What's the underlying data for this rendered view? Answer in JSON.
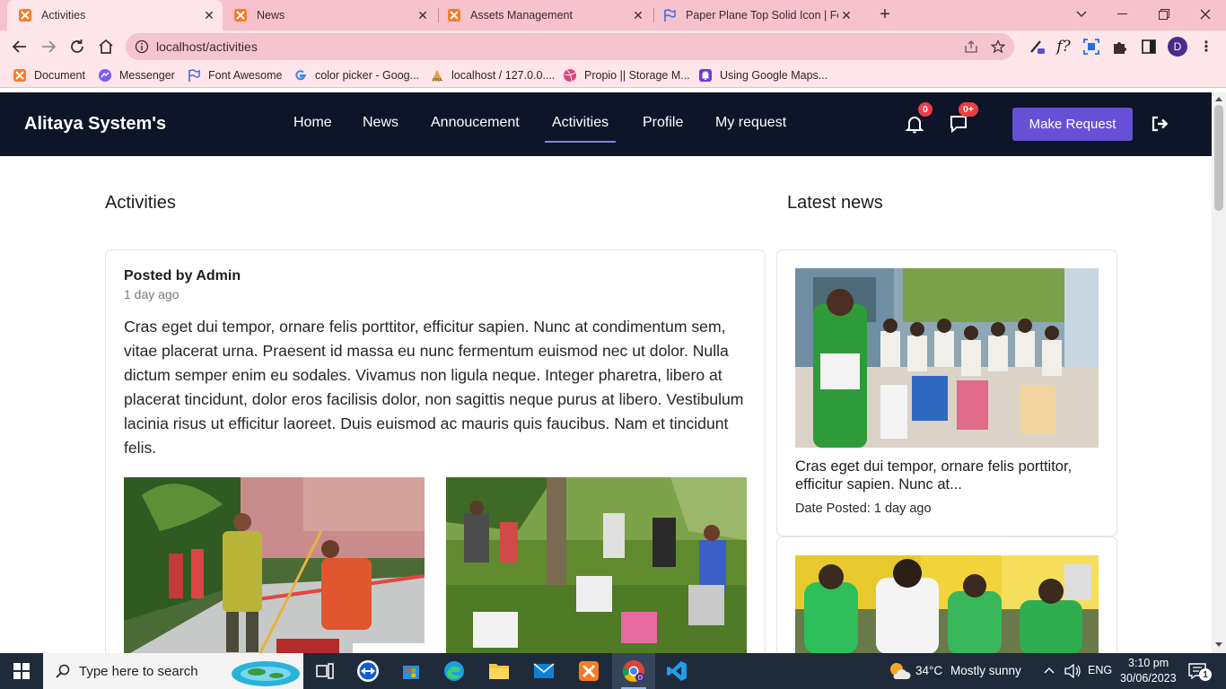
{
  "browser": {
    "tabs": [
      {
        "title": "Activities",
        "active": true
      },
      {
        "title": "News",
        "active": false
      },
      {
        "title": "Assets Management",
        "active": false
      },
      {
        "title": "Paper Plane Top Solid Icon | Font",
        "active": false
      }
    ],
    "address": "localhost/activities",
    "bookmarks": [
      "Document",
      "Messenger",
      "Font Awesome",
      "color picker - Goog...",
      "localhost / 127.0.0....",
      "Propio || Storage M...",
      "Using Google Maps..."
    ],
    "profile_initial": "D",
    "colors": {
      "tab_strip": "#f7c1cd",
      "toolbar": "#fde5ea"
    }
  },
  "app": {
    "brand": "Alitaya System's",
    "nav": {
      "home": "Home",
      "news": "News",
      "announcement": "Annoucement",
      "activities": "Activities",
      "profile": "Profile",
      "my_request": "My request"
    },
    "active_nav": "Activities",
    "notifications_badge": "0",
    "messages_badge": "0+",
    "make_request": "Make Request",
    "colors": {
      "navbar": "#0e1528",
      "accent": "#6651d6",
      "badge": "#ee3e45"
    }
  },
  "activities": {
    "heading": "Activities",
    "post": {
      "author": "Posted by Admin",
      "time": "1 day ago",
      "body": "Cras eget dui tempor, ornare felis porttitor, efficitur sapien. Nunc at condimentum sem, vitae placerat urna. Praesent id massa eu nunc fermentum euismod nec ut dolor. Nulla dictum semper enim eu sodales. Vivamus non ligula neque. Integer pharetra, libero at placerat tincidunt, dolor eros facilisis dolor, non sagittis neque purus at libero. Vestibulum lacinia risus ut efficitur laoreet. Duis euismod ac mauris quis faucibus. Nam et tincidunt felis."
    }
  },
  "latest_news": {
    "heading": "Latest news",
    "items": [
      {
        "title": "Cras eget dui tempor, ornare felis porttitor, efficitur sapien. Nunc at...",
        "date": "Date Posted: 1 day ago"
      }
    ]
  },
  "taskbar": {
    "search_placeholder": "Type here to search",
    "weather_temp": "34°C",
    "weather_text": "Mostly sunny",
    "language": "ENG",
    "time": "3:10 pm",
    "date": "30/06/2023",
    "notification_count": "1"
  }
}
